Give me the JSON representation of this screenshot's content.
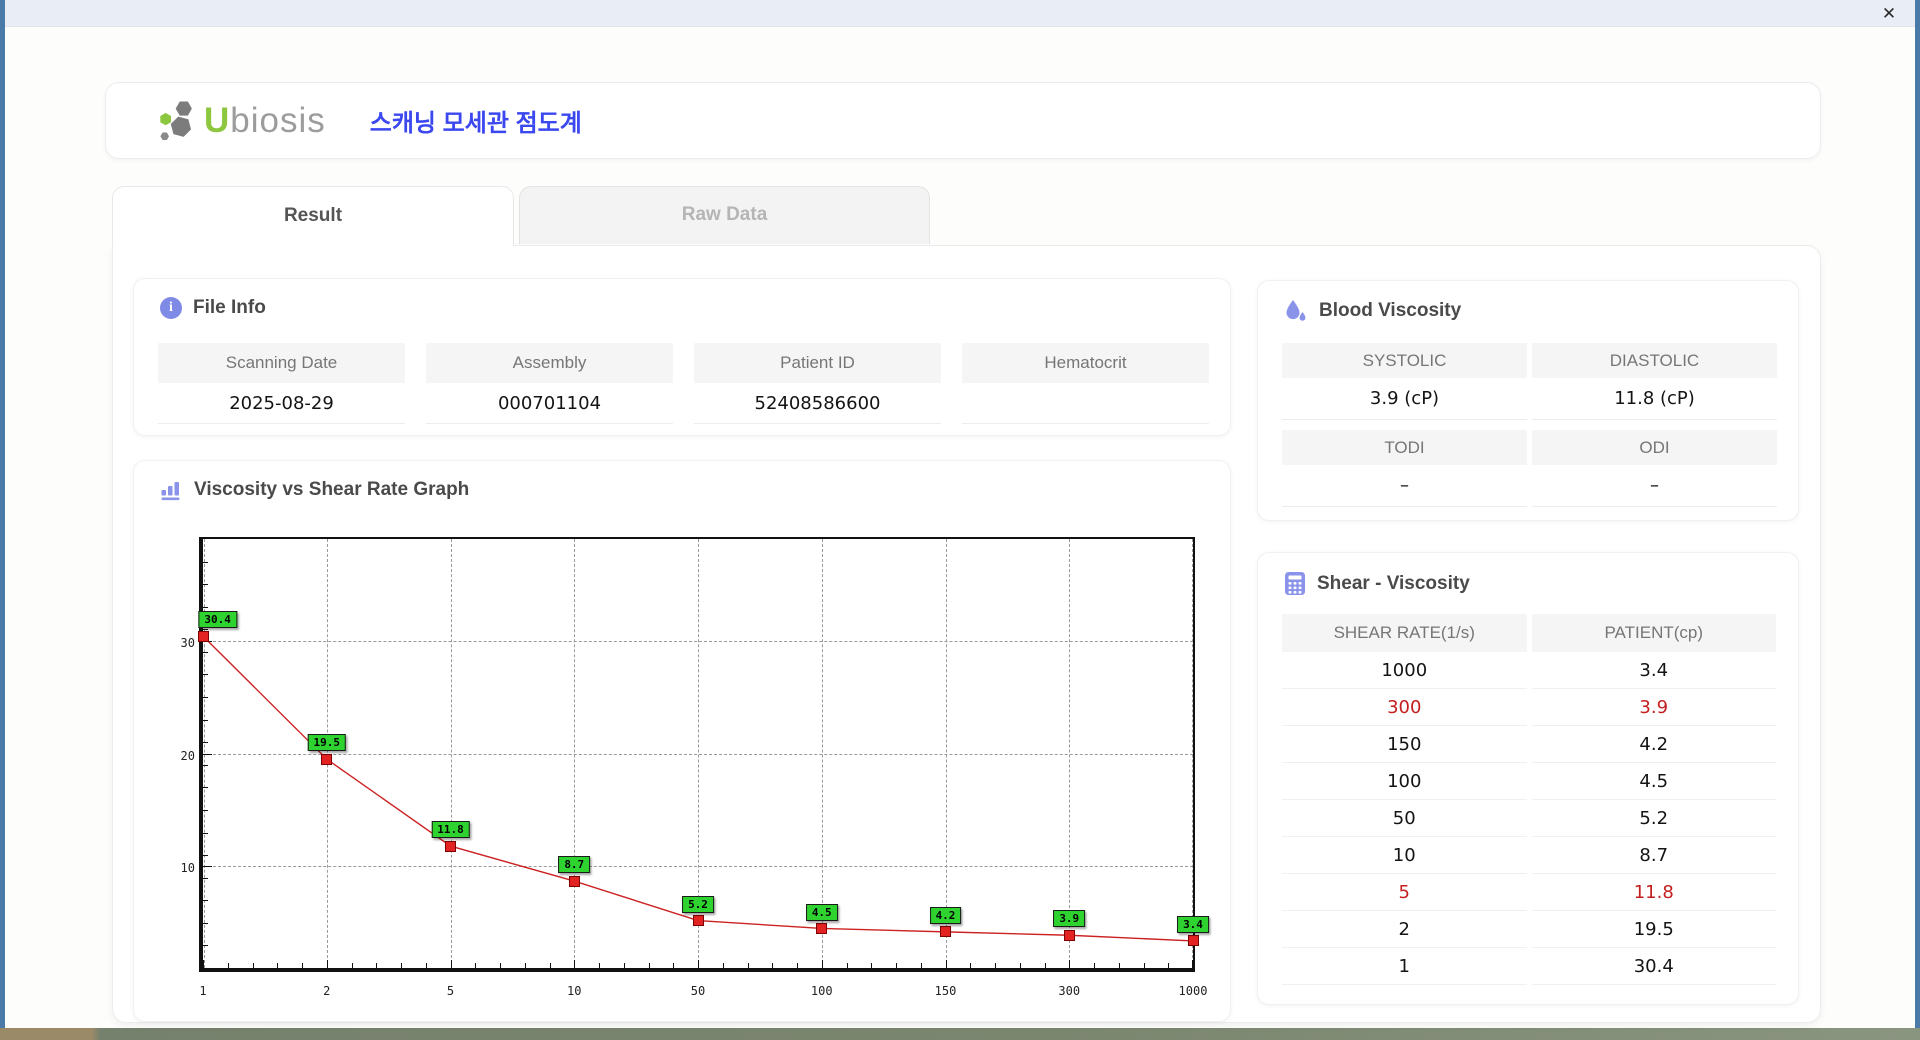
{
  "window": {
    "close_icon": "✕"
  },
  "header": {
    "logo_u": "U",
    "logo_rest": "biosis",
    "title_ko": "스캐닝 모세관 점도계"
  },
  "tabs": [
    {
      "label": "Result",
      "active": true
    },
    {
      "label": "Raw Data",
      "active": false
    }
  ],
  "file_info": {
    "section_title": "File Info",
    "fields": [
      {
        "label": "Scanning Date",
        "value": "2025-08-29"
      },
      {
        "label": "Assembly",
        "value": "000701104"
      },
      {
        "label": "Patient ID",
        "value": "52408586600"
      },
      {
        "label": "Hematocrit",
        "value": ""
      }
    ]
  },
  "blood_viscosity": {
    "section_title": "Blood Viscosity",
    "groups": [
      {
        "cells": [
          {
            "label": "SYSTOLIC",
            "value": "3.9 (cP)"
          },
          {
            "label": "DIASTOLIC",
            "value": "11.8 (cP)"
          }
        ]
      },
      {
        "cells": [
          {
            "label": "TODI",
            "value": "–"
          },
          {
            "label": "ODI",
            "value": "–"
          }
        ]
      }
    ]
  },
  "graph_section": {
    "section_title": "Viscosity vs Shear Rate Graph"
  },
  "chart_data": {
    "type": "line",
    "title": "Viscosity vs Shear Rate Graph",
    "x": [
      "1",
      "2",
      "5",
      "10",
      "50",
      "100",
      "150",
      "300",
      "1000"
    ],
    "x_axis_type": "categorical-equal-spacing",
    "values": [
      30.4,
      19.5,
      11.8,
      8.7,
      5.2,
      4.5,
      4.2,
      3.9,
      3.4
    ],
    "point_labels": [
      "30.4",
      "19.5",
      "11.8",
      "8.7",
      "5.2",
      "4.5",
      "4.2",
      "3.9",
      "3.4"
    ],
    "y_ticks": [
      10,
      20,
      30
    ],
    "ylim": [
      1,
      39
    ],
    "grid": "dashed",
    "line_color": "#cc2222",
    "marker_color": "#e32222",
    "label_bg": "#2fd32f",
    "legend": "none"
  },
  "shear_viscosity": {
    "section_title": "Shear - Viscosity",
    "columns": [
      "SHEAR RATE(1/s)",
      "PATIENT(cp)"
    ],
    "rows": [
      {
        "rate": "1000",
        "patient": "3.4",
        "highlight": false
      },
      {
        "rate": "300",
        "patient": "3.9",
        "highlight": true
      },
      {
        "rate": "150",
        "patient": "4.2",
        "highlight": false
      },
      {
        "rate": "100",
        "patient": "4.5",
        "highlight": false
      },
      {
        "rate": "50",
        "patient": "5.2",
        "highlight": false
      },
      {
        "rate": "10",
        "patient": "8.7",
        "highlight": false
      },
      {
        "rate": "5",
        "patient": "11.8",
        "highlight": true
      },
      {
        "rate": "2",
        "patient": "19.5",
        "highlight": false
      },
      {
        "rate": "1",
        "patient": "30.4",
        "highlight": false
      }
    ],
    "highlight_color": "#c41f1f"
  }
}
